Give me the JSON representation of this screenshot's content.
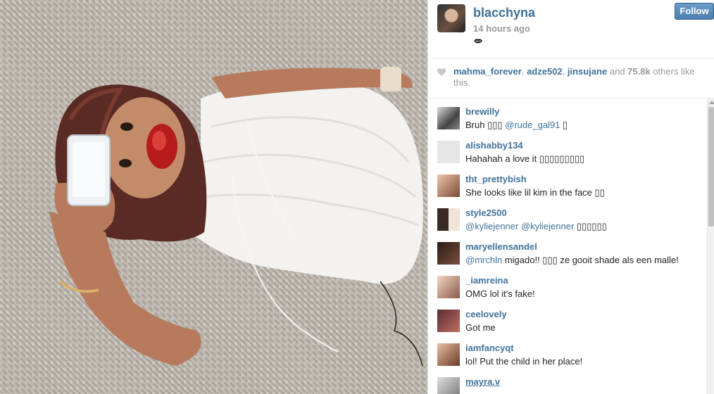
{
  "post": {
    "username": "blacchyna",
    "time_ago": "14 hours ago",
    "caption_emoji": "kiss-lips-icon",
    "follow_label": "Follow"
  },
  "likes": {
    "users": [
      "mahma_forever",
      "adze502",
      "jinsujane"
    ],
    "sep1": ", ",
    "sep2": ", ",
    "and": " and ",
    "count": "75.8k",
    "suffix": " others like this."
  },
  "comments": [
    {
      "user": "brewilly",
      "text": "Bruh ▯▯▯ ",
      "mention": "@rude_gal91",
      "text2": " ▯"
    },
    {
      "user": "alishabby134",
      "text": "Hahahah a love it ▯▯▯▯▯▯▯▯▯"
    },
    {
      "user": "tht_prettybish",
      "text": "She looks like lil kim in the face ▯▯"
    },
    {
      "user": "style2500",
      "mention": "@kyliejenner @kyliejenner",
      "text2": " ▯▯▯▯▯▯"
    },
    {
      "user": "maryellensandel",
      "mention": "@mrchln",
      "text2": " migado!! ▯▯▯ ze gooit shade als een malle!"
    },
    {
      "user": "_iamreina",
      "text": "OMG lol it's fake!"
    },
    {
      "user": "ceelovely",
      "text": "Got me"
    },
    {
      "user": "iamfancyqt",
      "text": "lol! Put the child in her place!"
    },
    {
      "user": "mayra.v",
      "text": ""
    }
  ],
  "colors": {
    "link": "#3f729b",
    "follow_bg": "#4c7fb0",
    "muted": "#999999"
  }
}
